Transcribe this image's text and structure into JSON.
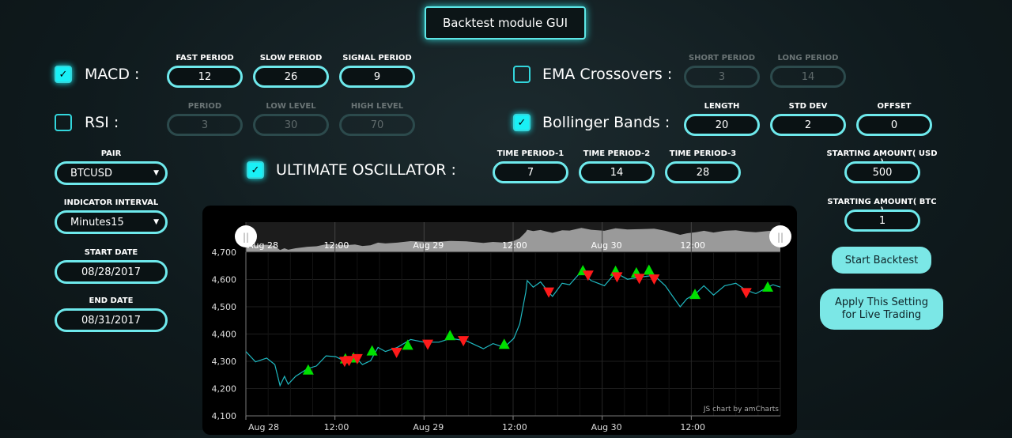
{
  "title": "Backtest module GUI",
  "macd": {
    "label": "MACD :",
    "checked": true,
    "fields": [
      {
        "label": "FAST PERIOD",
        "value": "12"
      },
      {
        "label": "SLOW PERIOD",
        "value": "26"
      },
      {
        "label": "SIGNAL PERIOD",
        "value": "9"
      }
    ]
  },
  "rsi": {
    "label": "RSI :",
    "checked": false,
    "fields": [
      {
        "label": "PERIOD",
        "value": "3"
      },
      {
        "label": "LOW LEVEL",
        "value": "30"
      },
      {
        "label": "HIGH LEVEL",
        "value": "70"
      }
    ]
  },
  "ema": {
    "label": "EMA Crossovers :",
    "checked": false,
    "fields": [
      {
        "label": "SHORT PERIOD",
        "value": "3"
      },
      {
        "label": "LONG PERIOD",
        "value": "14"
      }
    ]
  },
  "bb": {
    "label": "Bollinger Bands :",
    "checked": true,
    "fields": [
      {
        "label": "LENGTH",
        "value": "20"
      },
      {
        "label": "STD DEV",
        "value": "2"
      },
      {
        "label": "OFFSET",
        "value": "0"
      }
    ]
  },
  "uo": {
    "label": "ULTIMATE OSCILLATOR :",
    "checked": true,
    "fields": [
      {
        "label": "TIME PERIOD-1",
        "value": "7"
      },
      {
        "label": "TIME PERIOD-2",
        "value": "14"
      },
      {
        "label": "TIME PERIOD-3",
        "value": "28"
      }
    ]
  },
  "left": {
    "pair_label": "PAIR",
    "pair": "BTCUSD",
    "interval_label": "INDICATOR INTERVAL",
    "interval": "Minutes15",
    "start_label": "START DATE",
    "start": "08/28/2017",
    "end_label": "END DATE",
    "end": "08/31/2017"
  },
  "right": {
    "usd_label": "STARTING AMOUNT( USD )",
    "usd": "500",
    "btc_label": "STARTING AMOUNT( BTC )",
    "btc": "1",
    "start_button": "Start Backtest",
    "apply_button": "Apply This Setting for Live Trading"
  },
  "colors": {
    "accent": "#5de6e6",
    "line": "#1fb8c0",
    "buy": "#00e000",
    "sell": "#ff1a1a"
  },
  "chart_data": {
    "type": "line",
    "credit": "JS chart by amCharts",
    "ylim": [
      4100,
      4700
    ],
    "yticks": [
      "4,100",
      "4,200",
      "4,300",
      "4,400",
      "4,500",
      "4,600",
      "4,700"
    ],
    "xticks": [
      "Aug 28",
      "12:00",
      "Aug 29",
      "12:00",
      "Aug 30",
      "12:00"
    ],
    "x_unit": "hours since Aug 28 00:00",
    "price": [
      [
        0,
        4336
      ],
      [
        1.3,
        4298
      ],
      [
        2.8,
        4312
      ],
      [
        3.9,
        4288
      ],
      [
        4.6,
        4211
      ],
      [
        5.2,
        4245
      ],
      [
        5.7,
        4216
      ],
      [
        6.7,
        4245
      ],
      [
        8.3,
        4273
      ],
      [
        9.5,
        4283
      ],
      [
        10.8,
        4320
      ],
      [
        12.1,
        4317
      ],
      [
        13.2,
        4302
      ],
      [
        14.7,
        4317
      ],
      [
        15.7,
        4288
      ],
      [
        16.8,
        4302
      ],
      [
        17.8,
        4351
      ],
      [
        18.8,
        4336
      ],
      [
        20.4,
        4351
      ],
      [
        22.2,
        4380
      ],
      [
        24,
        4370
      ],
      [
        26,
        4370
      ],
      [
        27.6,
        4384
      ],
      [
        29.7,
        4375
      ],
      [
        32,
        4346
      ],
      [
        33.3,
        4365
      ],
      [
        34.8,
        4351
      ],
      [
        36.1,
        4384
      ],
      [
        36.9,
        4437
      ],
      [
        37.7,
        4553
      ],
      [
        37.9,
        4596
      ],
      [
        38.7,
        4572
      ],
      [
        39.7,
        4591
      ],
      [
        40.8,
        4553
      ],
      [
        41.3,
        4538
      ],
      [
        42.6,
        4586
      ],
      [
        43.6,
        4581
      ],
      [
        45.2,
        4630
      ],
      [
        46.5,
        4596
      ],
      [
        48.3,
        4577
      ],
      [
        49.8,
        4625
      ],
      [
        51.4,
        4601
      ],
      [
        53.4,
        4610
      ],
      [
        55,
        4615
      ],
      [
        56.5,
        4577
      ],
      [
        57.5,
        4538
      ],
      [
        58.5,
        4500
      ],
      [
        59.4,
        4529
      ],
      [
        60.6,
        4548
      ],
      [
        61.7,
        4577
      ],
      [
        63,
        4543
      ],
      [
        64.5,
        4577
      ],
      [
        66,
        4586
      ],
      [
        67.3,
        4562
      ],
      [
        68.7,
        4548
      ],
      [
        70,
        4567
      ],
      [
        71,
        4581
      ],
      [
        72,
        4572
      ]
    ],
    "buy": [
      [
        8.4,
        4266
      ],
      [
        13.4,
        4307
      ],
      [
        14.5,
        4310
      ],
      [
        17,
        4336
      ],
      [
        21.8,
        4357
      ],
      [
        27.5,
        4392
      ],
      [
        34.8,
        4360
      ],
      [
        45.4,
        4630
      ],
      [
        49.8,
        4628
      ],
      [
        52.6,
        4622
      ],
      [
        54.3,
        4632
      ],
      [
        60.5,
        4543
      ],
      [
        70.3,
        4570
      ]
    ],
    "sell": [
      [
        13.3,
        4302
      ],
      [
        13.9,
        4305
      ],
      [
        15,
        4312
      ],
      [
        20.3,
        4335
      ],
      [
        24.5,
        4365
      ],
      [
        29.3,
        4378
      ],
      [
        40.8,
        4556
      ],
      [
        46.1,
        4618
      ],
      [
        50,
        4612
      ],
      [
        53,
        4606
      ],
      [
        55,
        4604
      ],
      [
        67.4,
        4554
      ]
    ]
  }
}
